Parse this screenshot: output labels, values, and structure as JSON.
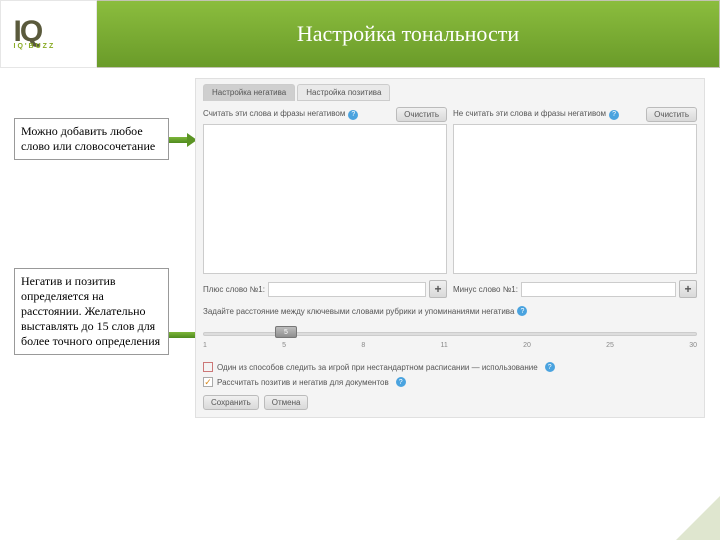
{
  "logo": {
    "main": "IQ",
    "sub": "IQ'BUZZ"
  },
  "title": "Настройка тональности",
  "annotations": {
    "a1": "Можно добавить любое слово или словосочетание",
    "a2": "Негатив и позитив определяется на расстоянии. Желательно выставлять до 15 слов для более точного определения"
  },
  "tabs": {
    "t1": "Настройка негатива",
    "t2": "Настройка позитива"
  },
  "columns": {
    "left": {
      "label": "Считать эти слова и фразы негативом",
      "clear": "Очистить"
    },
    "right": {
      "label": "Не считать эти слова и фразы негативом",
      "clear": "Очистить"
    }
  },
  "inputs": {
    "left_label": "Плюс слово №1:",
    "right_label": "Минус слово №1:"
  },
  "slider": {
    "label": "Задайте расстояние между ключевыми словами рубрики и упоминаниями негатива",
    "value": "5",
    "ticks": [
      "1",
      "5",
      "8",
      "11",
      "20",
      "25",
      "30"
    ]
  },
  "chk1": "Один из способов следить за игрой при нестандартном расписании — использование",
  "chk2": "Рассчитать позитив и негатив для документов",
  "buttons": {
    "save": "Сохранить",
    "cancel": "Отмена"
  }
}
